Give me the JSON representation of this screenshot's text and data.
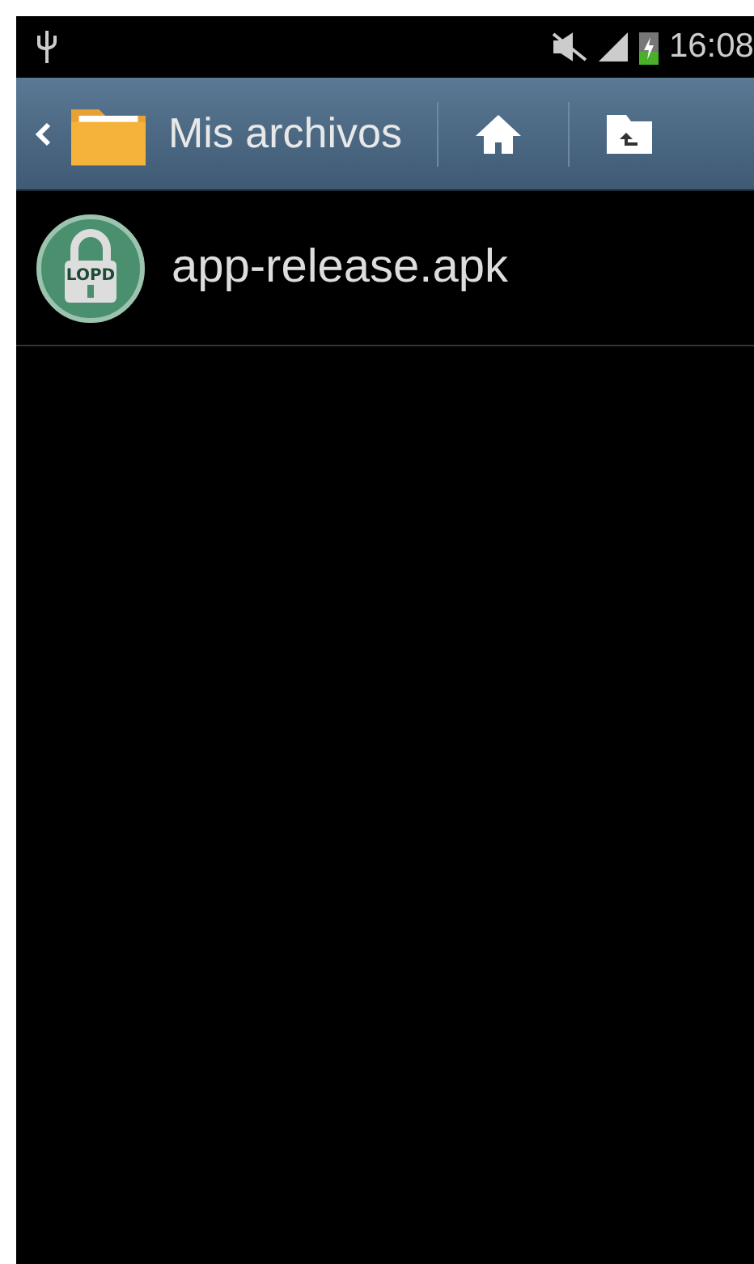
{
  "status_bar": {
    "time": "16:08"
  },
  "toolbar": {
    "title": "Mis archivos"
  },
  "files": [
    {
      "name": "app-release.apk",
      "icon_label": "LOPD"
    }
  ]
}
